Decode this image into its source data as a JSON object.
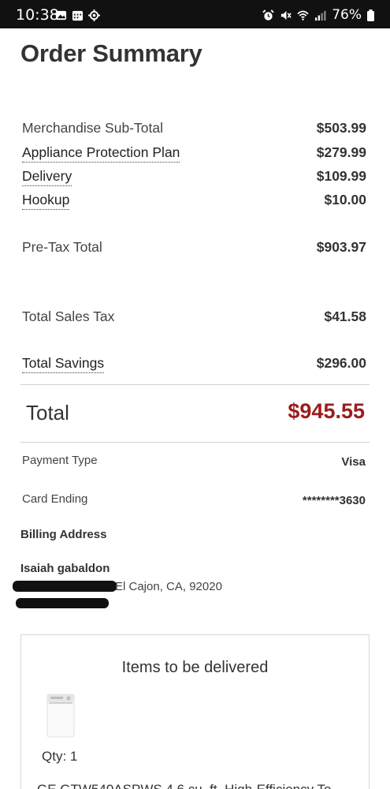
{
  "status_bar": {
    "time": "10:38",
    "battery": "76%",
    "icons_left": [
      "gallery-icon",
      "calendar-icon",
      "location-icon"
    ],
    "icons_right": [
      "alarm-icon",
      "mute-icon",
      "wifi-icon",
      "signal-icon",
      "battery-icon"
    ]
  },
  "page_title": "Order Summary",
  "summary": {
    "merchandise": {
      "label": "Merchandise Sub-Total",
      "value": "$503.99"
    },
    "protection_plan": {
      "label": "Appliance Protection Plan",
      "value": "$279.99"
    },
    "delivery": {
      "label": "Delivery",
      "value": "$109.99"
    },
    "hookup": {
      "label": "Hookup",
      "value": "$10.00"
    },
    "pretax": {
      "label": "Pre-Tax Total",
      "value": "$903.97"
    },
    "sales_tax": {
      "label": "Total Sales Tax",
      "value": "$41.58"
    },
    "savings": {
      "label": "Total Savings",
      "value": "$296.00"
    },
    "total": {
      "label": "Total",
      "value": "$945.55"
    }
  },
  "payment": {
    "type": {
      "label": "Payment Type",
      "value": "Visa"
    },
    "card": {
      "label": "Card Ending",
      "value": "********3630"
    }
  },
  "billing": {
    "heading": "Billing Address",
    "name": "Isaiah gabaldon",
    "city_line": "El Cajon, CA, 92020"
  },
  "delivery_items": {
    "heading": "Items to be delivered",
    "qty": "Qty: 1",
    "item_name": "GE GTW540ASPWS 4.6 cu. ft. High-Efficiency To"
  },
  "colors": {
    "total_price": "#9b1c1c",
    "status_bar": "#111111"
  }
}
